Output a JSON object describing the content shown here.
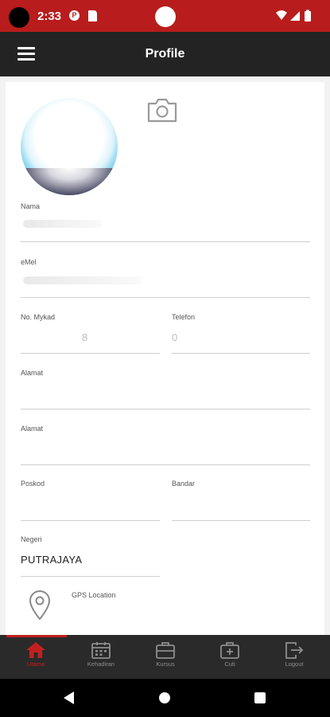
{
  "status_bar": {
    "time": "2:33",
    "notification_letter": "P"
  },
  "app_bar": {
    "title": "Profile"
  },
  "form": {
    "nama": {
      "label": "Nama",
      "value": ""
    },
    "emel": {
      "label": "eMel",
      "value": ""
    },
    "mykad": {
      "label": "No. Mykad",
      "value": "8"
    },
    "telefon": {
      "label": "Telefon",
      "value": "0"
    },
    "alamat1": {
      "label": "Alamat",
      "value": ""
    },
    "alamat2": {
      "label": "Alamat",
      "value": ""
    },
    "poskod": {
      "label": "Poskod",
      "value": ""
    },
    "bandar": {
      "label": "Bandar",
      "value": ""
    },
    "negeri": {
      "label": "Negeri",
      "value": "PUTRAJAYA"
    },
    "gps": {
      "label": "GPS Location"
    }
  },
  "bottom_nav": {
    "active_index": 0,
    "items": [
      {
        "label": "Utama",
        "icon": "home-icon"
      },
      {
        "label": "Kehadiran",
        "icon": "calendar-icon"
      },
      {
        "label": "Kursus",
        "icon": "briefcase-icon"
      },
      {
        "label": "Cuti",
        "icon": "medical-bag-icon"
      },
      {
        "label": "Logout",
        "icon": "logout-icon"
      }
    ]
  },
  "colors": {
    "accent": "#b81c1c",
    "app_bar": "#232323",
    "nav_bar": "#2a2a2a",
    "active": "#c42020"
  }
}
